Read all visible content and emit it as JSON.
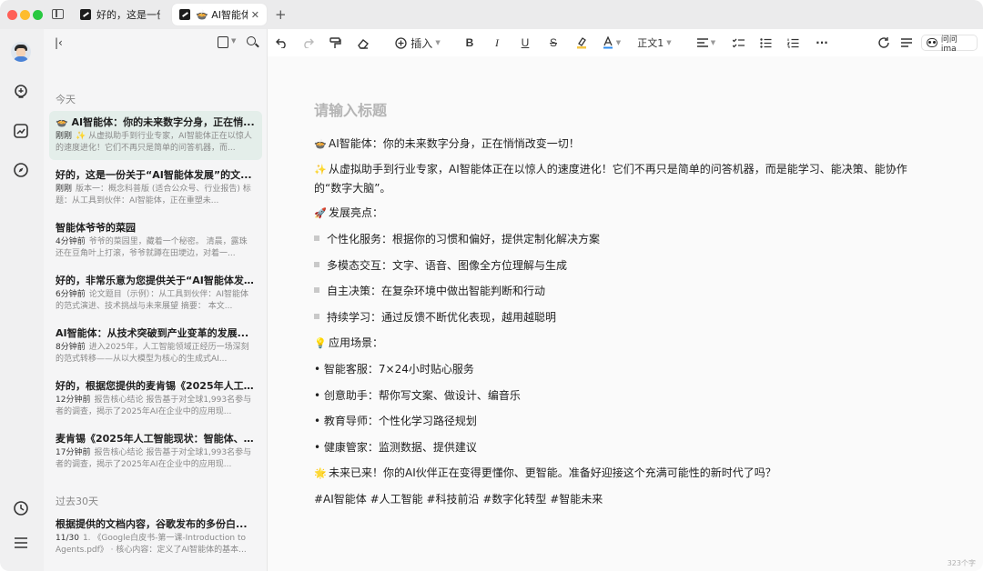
{
  "tabs": [
    {
      "label": "好的，这是一份关",
      "active": false
    },
    {
      "label": "🍲 AI智能体",
      "active": true
    }
  ],
  "tab_close": "✕",
  "new_tab": "+",
  "list": {
    "section_today": "今天",
    "section_30days": "过去30天",
    "notes": [
      {
        "title": "🍲 AI智能体：你的未来数字分身，正在悄...",
        "time": "刚刚",
        "snippet": "✨ 从虚拟助手到行业专家，AI智能体正在以惊人的速度进化！它们不再只是简单的问答机器，而..."
      },
      {
        "title": "好的，这是一份关于“AI智能体发展”的文...",
        "time": "刚刚",
        "snippet": "版本一：概念科普版 (适合公众号、行业报告) 标题：从工具到伙伴：AI智能体，正在重塑未..."
      },
      {
        "title": "智能体爷爷的菜园",
        "time": "4分钟前",
        "snippet": "爷爷的菜园里，藏着一个秘密。 清晨，露珠还在豆角叶上打滚，爷爷就蹲在田埂边，对着一..."
      },
      {
        "title": "好的，非常乐意为您提供关于“AI智能体发...",
        "time": "6分钟前",
        "snippet": "论文题目（示例）：从工具到伙伴：AI智能体的范式演进、技术挑战与未来展望 摘要： 本文..."
      },
      {
        "title": "AI智能体：从技术突破到产业变革的发展...",
        "time": "8分钟前",
        "snippet": "进入2025年，人工智能领域正经历一场深刻的范式转移——从以大模型为核心的生成式AI..."
      },
      {
        "title": "好的，根据您提供的麦肯锡《2025年人工...",
        "time": "12分钟前",
        "snippet": "报告核心结论 报告基于对全球1,993名参与者的调查，揭示了2025年AI在企业中的应用现..."
      },
      {
        "title": "麦肯锡《2025年人工智能现状：智能体、...",
        "time": "17分钟前",
        "snippet": "报告核心结论 报告基于对全球1,993名参与者的调查，揭示了2025年AI在企业中的应用现..."
      },
      {
        "title": "根据提供的文档内容，谷歌发布的多份白...",
        "time": "11/30",
        "snippet": "1. 《Google白皮书-第一课-Introduction to Agents.pdf》 · 核心内容：定义了AI智能体的基本..."
      }
    ]
  },
  "toolbar": {
    "insert_label": "插入",
    "text_style_label": "正文1",
    "ask_label": "问问ima",
    "more": "···"
  },
  "editor": {
    "title_placeholder": "请输入标题",
    "paragraphs": [
      {
        "emoji": "🍲",
        "text": "AI智能体：你的未来数字分身，正在悄悄改变一切！"
      },
      {
        "emoji": "✨",
        "text": "从虚拟助手到行业专家，AI智能体正在以惊人的速度进化！它们不再只是简单的问答机器，而是能学习、能决策、能协作的“数字大脑”。"
      },
      {
        "emoji": "🚀",
        "text": "发展亮点："
      },
      {
        "emoji": "",
        "text": "个性化服务：根据你的习惯和偏好，提供定制化解决方案"
      },
      {
        "emoji": "",
        "text": "多模态交互：文字、语音、图像全方位理解与生成"
      },
      {
        "emoji": "",
        "text": "自主决策：在复杂环境中做出智能判断和行动"
      },
      {
        "emoji": "",
        "text": "持续学习：通过反馈不断优化表现，越用越聪明"
      },
      {
        "emoji": "💡",
        "text": "应用场景："
      },
      {
        "emoji": "",
        "text": "• 智能客服：7×24小时贴心服务"
      },
      {
        "emoji": "",
        "text": "• 创意助手：帮你写文案、做设计、编音乐"
      },
      {
        "emoji": "",
        "text": "• 教育导师：个性化学习路径规划"
      },
      {
        "emoji": "",
        "text": "• 健康管家：监测数据、提供建议"
      },
      {
        "emoji": "🌟",
        "text": "未来已来！你的AI伙伴正在变得更懂你、更智能。准备好迎接这个充满可能性的新时代了吗？"
      },
      {
        "emoji": "",
        "text": "#AI智能体 #人工智能 #科技前沿 #数字化转型 #智能未来"
      }
    ],
    "word_count": "323个字"
  }
}
